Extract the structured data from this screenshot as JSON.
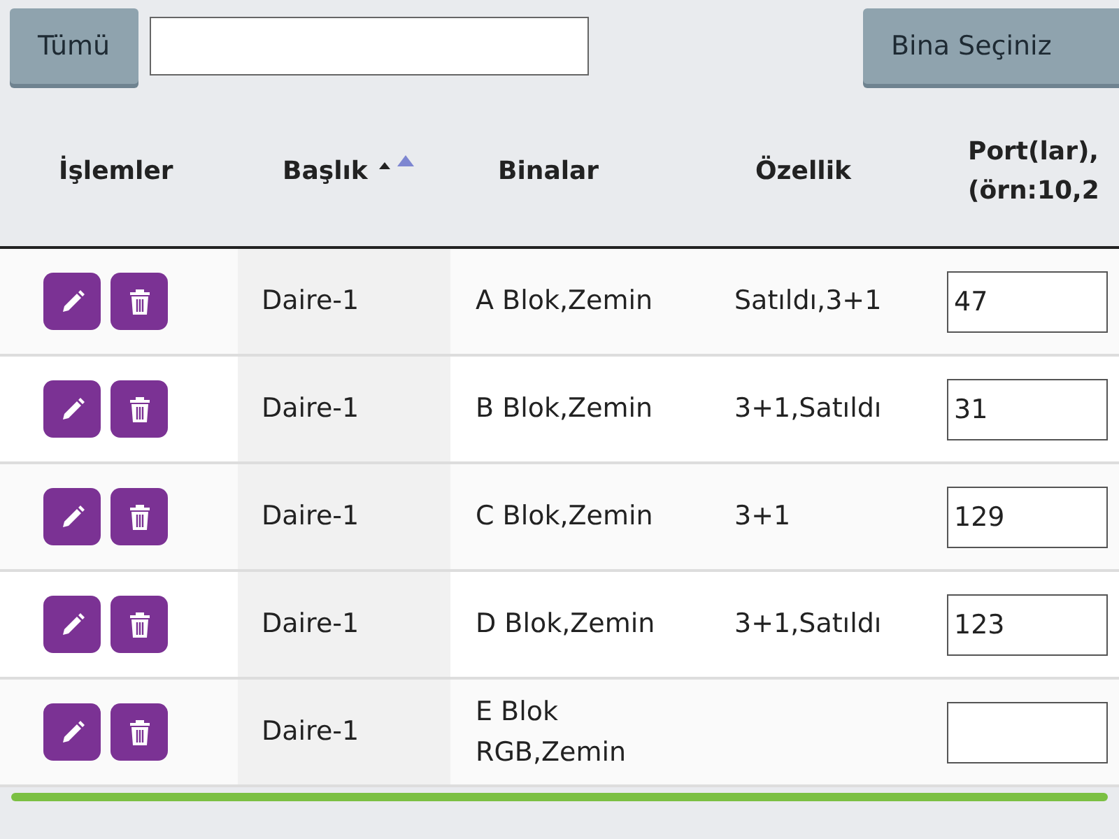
{
  "toolbar": {
    "all_button": "Tümü",
    "building_button": "Bina Seçiniz"
  },
  "table": {
    "columns": [
      {
        "label": "İşlemler",
        "sortable": false
      },
      {
        "label": "Başlık",
        "sortable": true
      },
      {
        "label": "Binalar",
        "sortable": false
      },
      {
        "label": "Özellik",
        "sortable": false
      },
      {
        "label": "Port(lar),\n(örn:10,2",
        "sortable": false
      }
    ],
    "rows": [
      {
        "title": "Daire-1",
        "buildings": "A Blok,Zemin",
        "feature": "Satıldı,3+1",
        "port": "47"
      },
      {
        "title": "Daire-1",
        "buildings": "B Blok,Zemin",
        "feature": "3+1,Satıldı",
        "port": "31"
      },
      {
        "title": "Daire-1",
        "buildings": "C Blok,Zemin",
        "feature": "3+1",
        "port": "129"
      },
      {
        "title": "Daire-1",
        "buildings": "D Blok,Zemin",
        "feature": "3+1,Satıldı",
        "port": "123"
      },
      {
        "title": "Daire-1",
        "buildings": "E Blok\nRGB,Zemin"
      }
    ]
  }
}
